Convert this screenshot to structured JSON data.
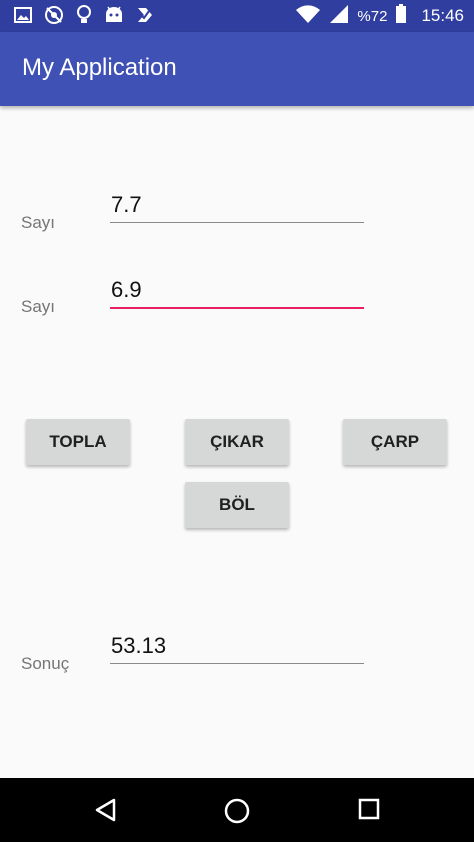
{
  "status_bar": {
    "icons": [
      "image-icon",
      "no-location-icon",
      "lightbulb-icon",
      "android-icon",
      "check-icon"
    ],
    "battery_text": "%72",
    "time": "15:46"
  },
  "app_bar": {
    "title": "My Application"
  },
  "form": {
    "first": {
      "label": "Sayı",
      "value": "7.7"
    },
    "second": {
      "label": "Sayı",
      "value": "6.9"
    },
    "result": {
      "label": "Sonuç",
      "value": "53.13"
    }
  },
  "buttons": {
    "add": "TOPLA",
    "subtract": "ÇIKAR",
    "multiply": "ÇARP",
    "divide": "BÖL"
  },
  "colors": {
    "primary": "#3f51b5",
    "primary_dark": "#303f9f",
    "accent": "#e91e63",
    "button": "#d6d7d7"
  }
}
